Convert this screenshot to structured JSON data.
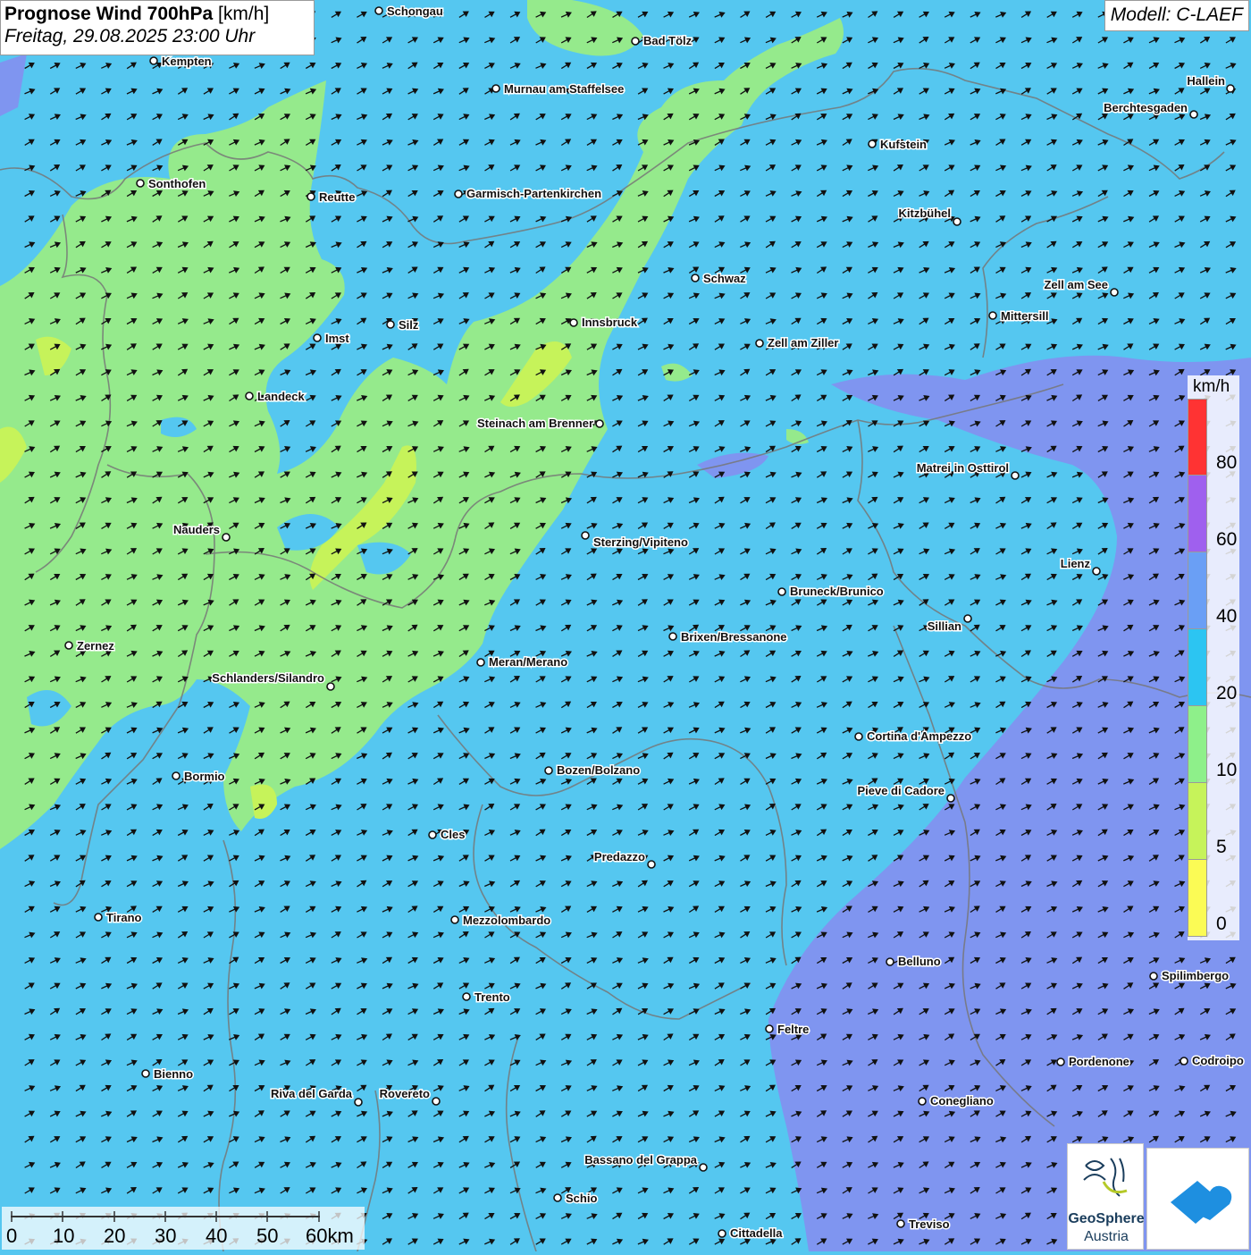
{
  "header": {
    "title_bold": "Prognose Wind 700hPa",
    "title_unit": "[km/h]",
    "datetime": "Freitag, 29.08.2025 23:00 Uhr"
  },
  "model": {
    "label": "Modell: C-LAEF"
  },
  "legend": {
    "unit": "km/h",
    "bands": [
      {
        "color": "#ff3333"
      },
      {
        "color": "#9f60ee"
      },
      {
        "color": "#6a9ff5"
      },
      {
        "color": "#2cc5f2"
      },
      {
        "color": "#8ef08a"
      },
      {
        "color": "#c6f35a"
      },
      {
        "color": "#fbfb55"
      }
    ],
    "labels": [
      "80",
      "60",
      "40",
      "20",
      "10",
      "5",
      "0"
    ]
  },
  "scale": {
    "labels": [
      "0",
      "10",
      "20",
      "30",
      "40",
      "50",
      "60km"
    ]
  },
  "cities": [
    {
      "name": "Schongau"
    },
    {
      "name": "Bad Tölz"
    },
    {
      "name": "Kempten"
    },
    {
      "name": "Murnau am Staffelsee"
    },
    {
      "name": "Hallein"
    },
    {
      "name": "Berchtesgaden"
    },
    {
      "name": "Kufstein"
    },
    {
      "name": "Sonthofen"
    },
    {
      "name": "Reutte"
    },
    {
      "name": "Garmisch-Partenkirchen"
    },
    {
      "name": "Kitzbühel"
    },
    {
      "name": "Schwaz"
    },
    {
      "name": "Zell am See"
    },
    {
      "name": "Mittersill"
    },
    {
      "name": "Innsbruck"
    },
    {
      "name": "Imst"
    },
    {
      "name": "Silz"
    },
    {
      "name": "Zell am Ziller"
    },
    {
      "name": "Landeck"
    },
    {
      "name": "Steinach am Brenner"
    },
    {
      "name": "Matrei in Osttirol"
    },
    {
      "name": "Nauders"
    },
    {
      "name": "Sterzing/Vipiteno"
    },
    {
      "name": "Lienz"
    },
    {
      "name": "Bruneck/Brunico"
    },
    {
      "name": "Sillian"
    },
    {
      "name": "Brixen/Bressanone"
    },
    {
      "name": "Zernez"
    },
    {
      "name": "Meran/Merano"
    },
    {
      "name": "Schlanders/Silandro"
    },
    {
      "name": "Cortina d'Ampezzo"
    },
    {
      "name": "Bozen/Bolzano"
    },
    {
      "name": "Bormio"
    },
    {
      "name": "Pieve di Cadore"
    },
    {
      "name": "Cles"
    },
    {
      "name": "Predazzo"
    },
    {
      "name": "Tirano"
    },
    {
      "name": "Mezzolombardo"
    },
    {
      "name": "Belluno"
    },
    {
      "name": "Spilimbergo"
    },
    {
      "name": "Trento"
    },
    {
      "name": "Feltre"
    },
    {
      "name": "Bienno"
    },
    {
      "name": "Pordenone"
    },
    {
      "name": "Codroipo"
    },
    {
      "name": "Riva del Garda"
    },
    {
      "name": "Rovereto"
    },
    {
      "name": "Conegliano"
    },
    {
      "name": "Bassano del Grappa"
    },
    {
      "name": "Schio"
    },
    {
      "name": "Treviso"
    },
    {
      "name": "Cittadella"
    }
  ],
  "logos": {
    "geosphere_line1": "GeoSphere",
    "geosphere_line2": "Austria"
  },
  "colors": {
    "background": "#55c7f0",
    "calm": "#95ea8c",
    "strong": "#7a8cf0"
  }
}
